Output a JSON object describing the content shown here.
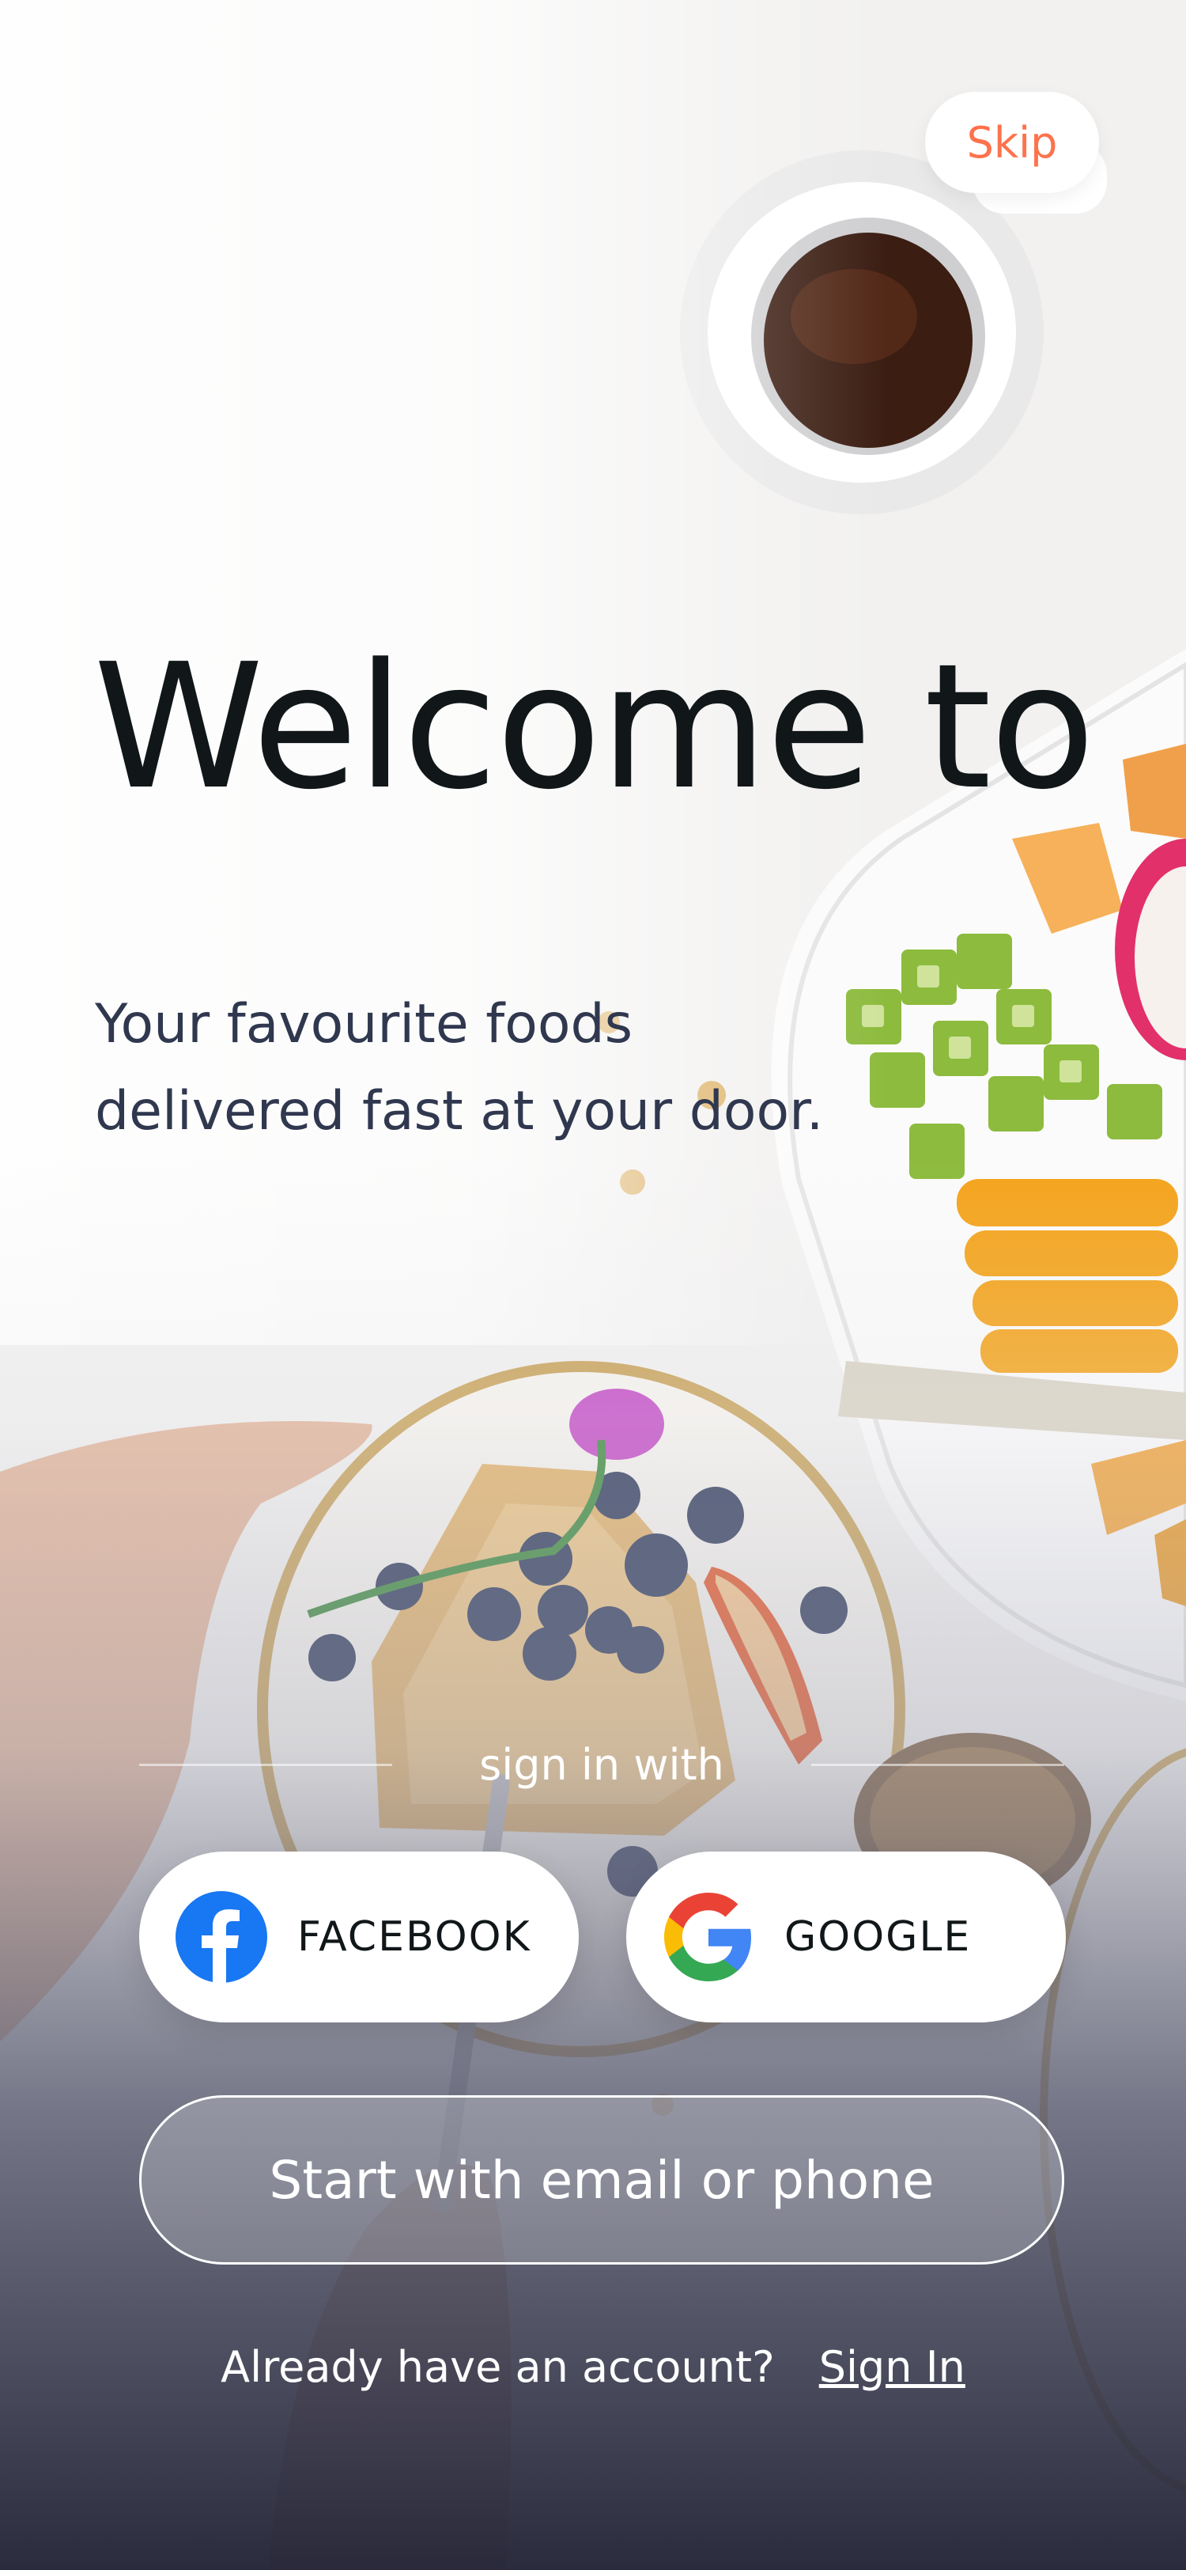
{
  "skip": {
    "label": "Skip"
  },
  "hero": {
    "title": "Welcome to",
    "subtitle": "Your favourite foods delivered fast at your door."
  },
  "divider": {
    "label": "sign in with"
  },
  "social": {
    "facebook": {
      "label": "FACEBOOK",
      "icon": "facebook-icon",
      "color": "#1877F2"
    },
    "google": {
      "label": "GOOGLE",
      "icon": "google-icon"
    }
  },
  "email_button": {
    "label": "Start with email or phone"
  },
  "footer": {
    "prompt": "Already have an account?",
    "signin_label": "Sign In"
  },
  "colors": {
    "accent": "#FE724C",
    "title": "#111719",
    "subtitle": "#30384F"
  }
}
